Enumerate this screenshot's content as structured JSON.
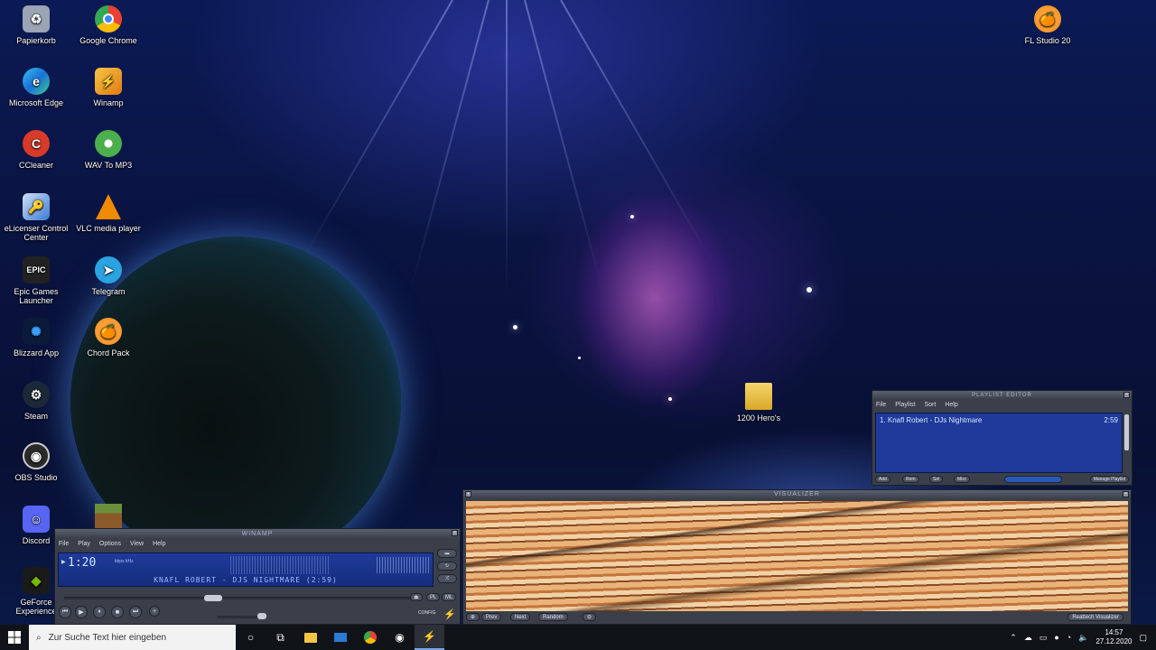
{
  "desktop_icons": [
    {
      "label": "Papierkorb",
      "icon": "recycle-bin-icon",
      "color": "#9aa4b4"
    },
    {
      "label": "Google Chrome",
      "icon": "chrome-icon",
      "color": "#e94235"
    },
    {
      "label": "Microsoft Edge",
      "icon": "edge-icon",
      "color": "#2aa0e8"
    },
    {
      "label": "Winamp",
      "icon": "winamp-icon",
      "color": "#f0a020"
    },
    {
      "label": "CCleaner",
      "icon": "ccleaner-icon",
      "color": "#d83a2a"
    },
    {
      "label": "WAV To MP3",
      "icon": "wav-to-mp3-icon",
      "color": "#4cae4c"
    },
    {
      "label": "eLicenser Control Center",
      "icon": "elicenser-icon",
      "color": "#3a7bd5"
    },
    {
      "label": "VLC media player",
      "icon": "vlc-icon",
      "color": "#f08a00"
    },
    {
      "label": "Epic Games Launcher",
      "icon": "epic-games-icon",
      "color": "#222222"
    },
    {
      "label": "Telegram",
      "icon": "telegram-icon",
      "color": "#2aa3e0"
    },
    {
      "label": "Blizzard App",
      "icon": "blizzard-icon",
      "color": "#1c6fd8"
    },
    {
      "label": "Chord Pack",
      "icon": "fl-studio-icon",
      "color": "#f58a1f"
    },
    {
      "label": "Steam",
      "icon": "steam-icon",
      "color": "#1b2838"
    },
    {
      "label": "OBS Studio",
      "icon": "obs-icon",
      "color": "#2a2a2a"
    },
    {
      "label": "Discord",
      "icon": "discord-icon",
      "color": "#5865f2"
    },
    {
      "label": "",
      "icon": "minecraft-icon",
      "color": "#6b8f3a"
    },
    {
      "label": "GeForce Experience",
      "icon": "geforce-icon",
      "color": "#76b900"
    },
    {
      "label": "FL Studio 20",
      "icon": "fl-studio-icon",
      "color": "#f58a1f"
    },
    {
      "label": "1200 Hero's",
      "icon": "folder-icon",
      "color": "#e8c040"
    }
  ],
  "winamp": {
    "title": "WINAMP",
    "menu": [
      "File",
      "Play",
      "Options",
      "View",
      "Help"
    ],
    "time": "1:20",
    "bitrate": "kbps",
    "khz": "kHz",
    "song": "KNAFL ROBERT - DJS NIGHTMARE (2:59)",
    "config_label": "CONFIG"
  },
  "playlist": {
    "title": "PLAYLIST EDITOR",
    "menu": [
      "File",
      "Playlist",
      "Sort",
      "Help"
    ],
    "items": [
      {
        "label": "1. Knafl Robert - DJs Nightmare",
        "duration": "2:59"
      }
    ],
    "buttons": [
      "Add",
      "Rem",
      "Sel",
      "Misc"
    ],
    "manage": "Manage Playlist"
  },
  "visualizer": {
    "title": "VISUALIZER",
    "buttons": [
      "Prev",
      "Next",
      "Random"
    ],
    "plugin": "Reattech Visualizer"
  },
  "taskbar": {
    "search_placeholder": "Zur Suche Text hier eingeben",
    "time": "14:57",
    "date": "27.12.2020"
  }
}
